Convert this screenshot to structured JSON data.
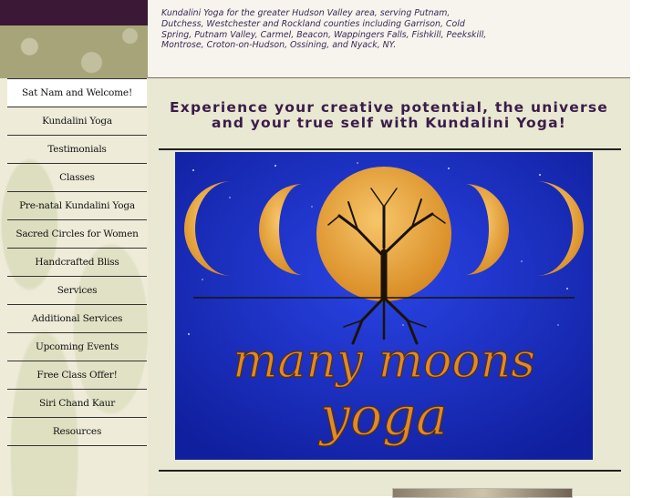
{
  "tagline": "Kundalini Yoga for the greater Hudson Valley area, serving Putnam, Dutchess, Westchester and Rockland counties including Garrison, Cold Spring, Putnam Valley, Carmel, Beacon, Wappingers Falls, Fishkill, Peekskill, Montrose, Croton-on-Hudson, Ossining, and Nyack, NY.",
  "nav": {
    "items": [
      "Sat  Nam and Welcome!",
      "Kundalini Yoga",
      "Testimonials",
      "Classes",
      "Pre-natal Kundalini Yoga",
      "Sacred Circles for Women",
      "Handcrafted Bliss",
      "Services",
      "Additional Services",
      "Upcoming Events",
      "Free Class Offer!",
      "Siri Chand Kaur",
      "Resources"
    ]
  },
  "main": {
    "headline": "Experience your creative potential, the universe and your true self with Kundalini Yoga!",
    "hero": {
      "line1": "many moons",
      "line2": "yoga"
    }
  },
  "colors": {
    "plum": "#3b1836",
    "sage": "#a7a47a",
    "main_bg": "#e9e8d2",
    "banner_blue": "#1b2fc4",
    "moon_gold": "#e9a640",
    "script_orange": "#e0892a"
  }
}
